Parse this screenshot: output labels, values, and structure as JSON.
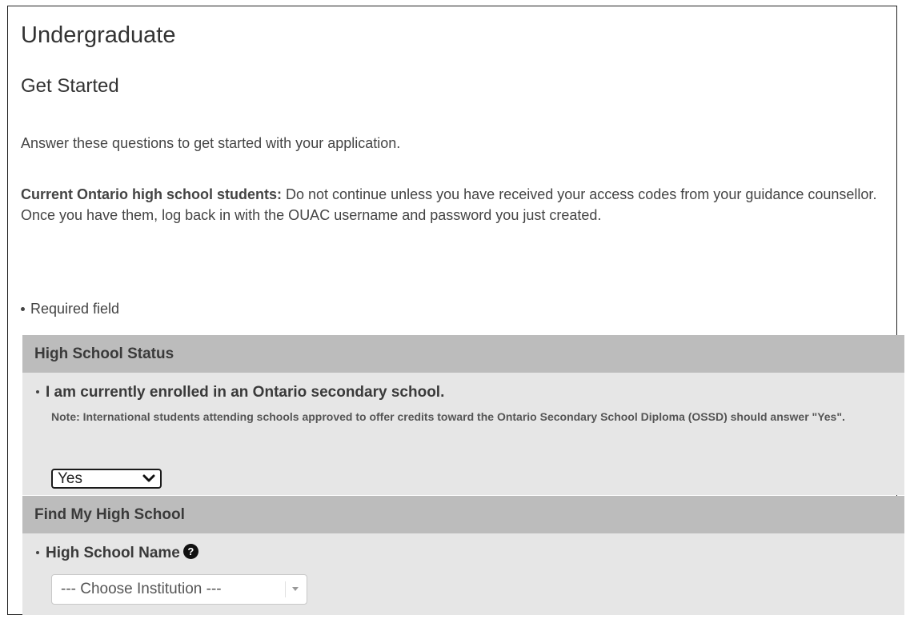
{
  "page": {
    "title": "Undergraduate",
    "subtitle": "Get Started",
    "intro": "Answer these questions to get started with your application.",
    "notice_bold": "Current Ontario high school students:",
    "notice_text": " Do not continue unless you have received your access codes from your guidance counsellor. Once you have them, log back in with the OUAC username and password you just created.",
    "required_note": "Required field"
  },
  "sections": {
    "high_school_status": {
      "header": "High School Status",
      "question": "I am currently enrolled in an Ontario secondary school.",
      "note": "Note: International students attending schools approved to offer credits toward the Ontario Secondary School Diploma (OSSD) should answer \"Yes\".",
      "selected_value": "Yes"
    },
    "find_high_school": {
      "header": "Find My High School",
      "field_label": "High School Name",
      "help_icon_glyph": "?",
      "select_placeholder": "--- Choose Institution ---"
    }
  },
  "icons": {
    "required": "bullet-icon",
    "help": "question-circle-icon",
    "dropdown": "chevron-down-icon",
    "caret": "caret-down-icon"
  }
}
